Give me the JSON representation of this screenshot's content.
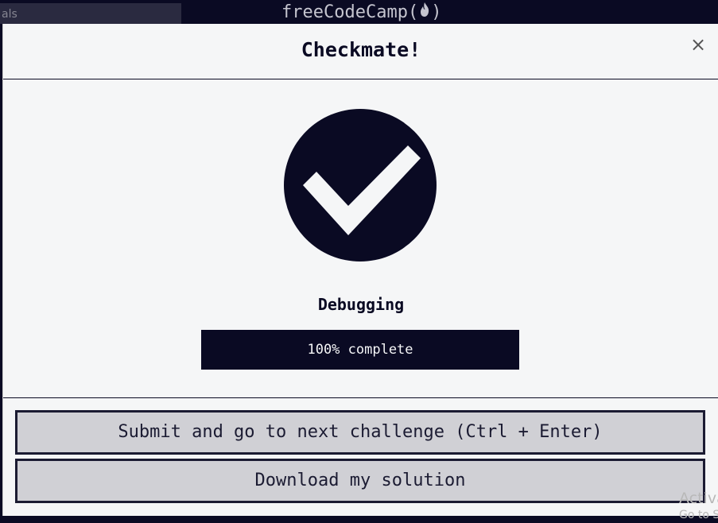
{
  "topbar": {
    "search_text": "als",
    "brand_left": "freeCodeCamp(",
    "brand_right": ")"
  },
  "modal": {
    "title": "Checkmate!",
    "close_symbol": "×",
    "block_name": "Debugging",
    "progress": {
      "percent": 100,
      "text": "100% complete"
    },
    "buttons": {
      "submit_label": "Submit and go to next challenge (Ctrl + Enter)",
      "download_label": "Download my solution"
    }
  },
  "watermark": {
    "line1": "Activa",
    "line2": "Go to Se"
  },
  "colors": {
    "accent": "#0a0a23",
    "modal_bg": "#f5f6f7",
    "button_bg": "#d0d0d5"
  },
  "icons": [
    "flame-icon",
    "checkmark-icon",
    "close-icon"
  ]
}
